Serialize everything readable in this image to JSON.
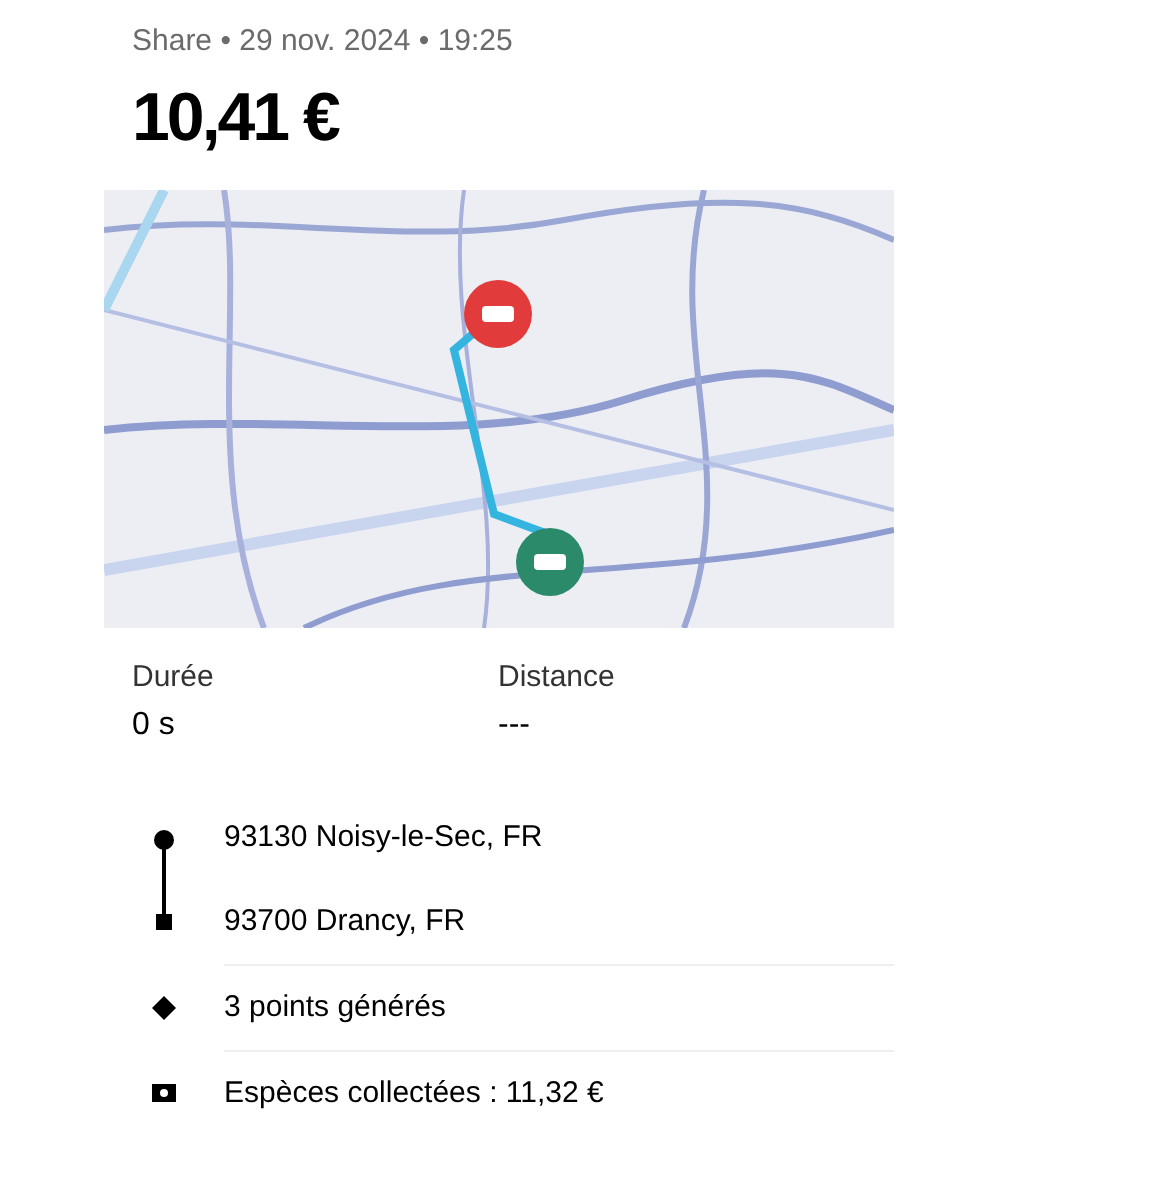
{
  "header": {
    "subtitle": "Share • 29 nov. 2024 • 19:25",
    "price": "10,41 €"
  },
  "stats": [
    {
      "label": "Durée",
      "value": "0 s"
    },
    {
      "label": "Distance",
      "value": "---"
    }
  ],
  "route": {
    "stops": [
      "93130 Noisy-le-Sec, FR",
      "93700 Drancy, FR"
    ]
  },
  "details": [
    {
      "kind": "points",
      "text": "3 points générés"
    },
    {
      "kind": "cash",
      "text": "Espèces collectées : 11,32 €"
    }
  ]
}
